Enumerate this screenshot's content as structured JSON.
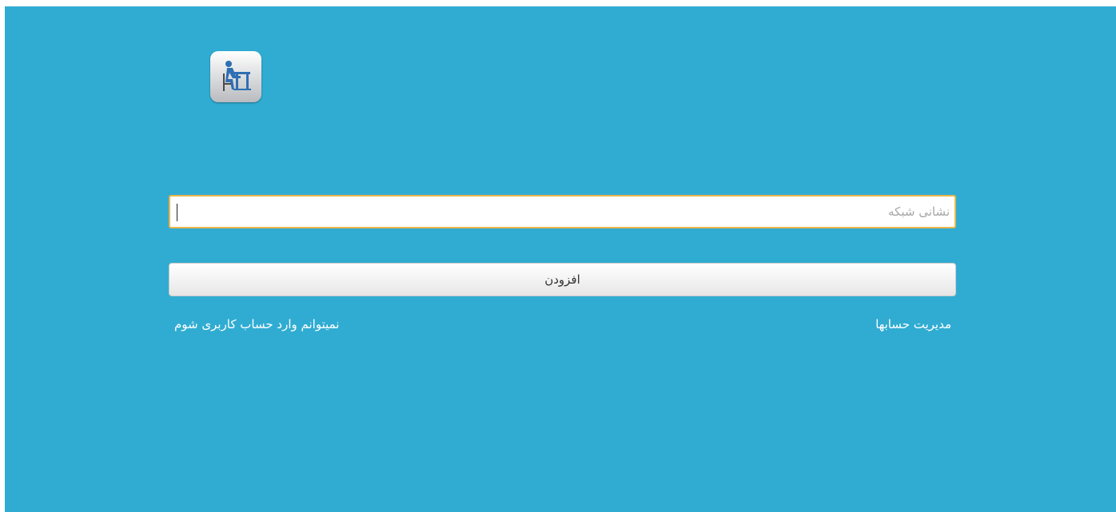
{
  "colors": {
    "background": "#30acd2",
    "input_border": "#e8b64a",
    "link_text": "#ffffff"
  },
  "logo": {
    "icon": "person-at-desk-icon"
  },
  "form": {
    "network_address_placeholder": "نشانی شبکه",
    "network_address_value": "",
    "add_button_label": "افزودن"
  },
  "links": {
    "manage_accounts": "مدیریت حسابها",
    "cant_login": "نمیتوانم وارد حساب کاربری شوم"
  }
}
